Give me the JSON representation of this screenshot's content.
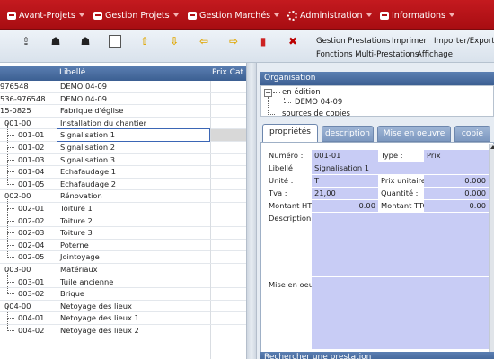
{
  "menubar": {
    "items": [
      "Avant-Projets",
      "Gestion Projets",
      "Gestion Marchés",
      "Administration",
      "Informations"
    ]
  },
  "toolbar": {
    "icons": [
      "import-icon",
      "users-icon",
      "users-add-icon",
      "document-icon",
      "arrow-up-icon",
      "arrow-down-icon",
      "arrow-left-icon",
      "arrow-right-icon",
      "trash-icon",
      "cancel-icon"
    ],
    "links": [
      "Gestion Prestations",
      "Imprimer",
      "Importer/Exporter",
      "Fonctions Multi-Prestations",
      "Affichage"
    ]
  },
  "table": {
    "columns": [
      "Libellé",
      "Prix Cat"
    ],
    "rows": [
      {
        "code": "976548",
        "label": "DEMO 04-09"
      },
      {
        "code": "536-976548",
        "label": "DEMO 04-09"
      },
      {
        "code": "15-0825",
        "label": "Fabrique d'église"
      },
      {
        "code": "001-00",
        "label": "Installation du chantier"
      },
      {
        "code": "001-01",
        "label": "Signalisation 1"
      },
      {
        "code": "001-02",
        "label": "Signalisation 2"
      },
      {
        "code": "001-03",
        "label": "Signalisation 3"
      },
      {
        "code": "001-04",
        "label": "Echafaudage 1"
      },
      {
        "code": "001-05",
        "label": "Echafaudage 2"
      },
      {
        "code": "002-00",
        "label": "Rénovation"
      },
      {
        "code": "002-01",
        "label": "Toiture 1"
      },
      {
        "code": "002-02",
        "label": "Toiture 2"
      },
      {
        "code": "002-03",
        "label": "Toiture 3"
      },
      {
        "code": "002-04",
        "label": "Poterne"
      },
      {
        "code": "002-05",
        "label": "Jointoyage"
      },
      {
        "code": "003-00",
        "label": "Matériaux"
      },
      {
        "code": "003-01",
        "label": "Tuile ancienne"
      },
      {
        "code": "003-02",
        "label": "Brique"
      },
      {
        "code": "004-00",
        "label": "Netoyage des lieux"
      },
      {
        "code": "004-01",
        "label": "Netoyage des lieux 1"
      },
      {
        "code": "004-02",
        "label": "Netoyage des lieux 2"
      }
    ],
    "selected_row": 4
  },
  "organisation": {
    "title": "Organisation",
    "nodes": [
      "en édition",
      "DEMO 04-09",
      "sources de copies"
    ]
  },
  "tabs": [
    "propriétés",
    "description",
    "Mise en oeuvre",
    "copie"
  ],
  "form": {
    "numero_label": "Numéro :",
    "numero_value": "001-01",
    "type_label": "Type :",
    "type_value": "Prix",
    "libelle_label": "Libellé",
    "libelle_value": "Signalisation 1",
    "unite_label": "Unité :",
    "unite_value": "T",
    "prix_unitaire_label": "Prix unitaire",
    "prix_unitaire_value": "0.000",
    "tva_label": "Tva :",
    "tva_value": "21,00",
    "quantite_label": "Quantité :",
    "quantite_value": "0.000",
    "montant_ht_label": "Montant HT",
    "montant_ht_value": "0.00",
    "montant_ttc_label": "Montant TTC",
    "montant_ttc_value": "0.00",
    "description_label": "Description",
    "mise_en_oeuvre_label": "Mise en oeuv"
  },
  "search": {
    "title": "Rechercher une prestation"
  },
  "colors": {
    "menubar": "#b01015",
    "header": "#4a6ea3",
    "field": "#c8ccf5"
  }
}
